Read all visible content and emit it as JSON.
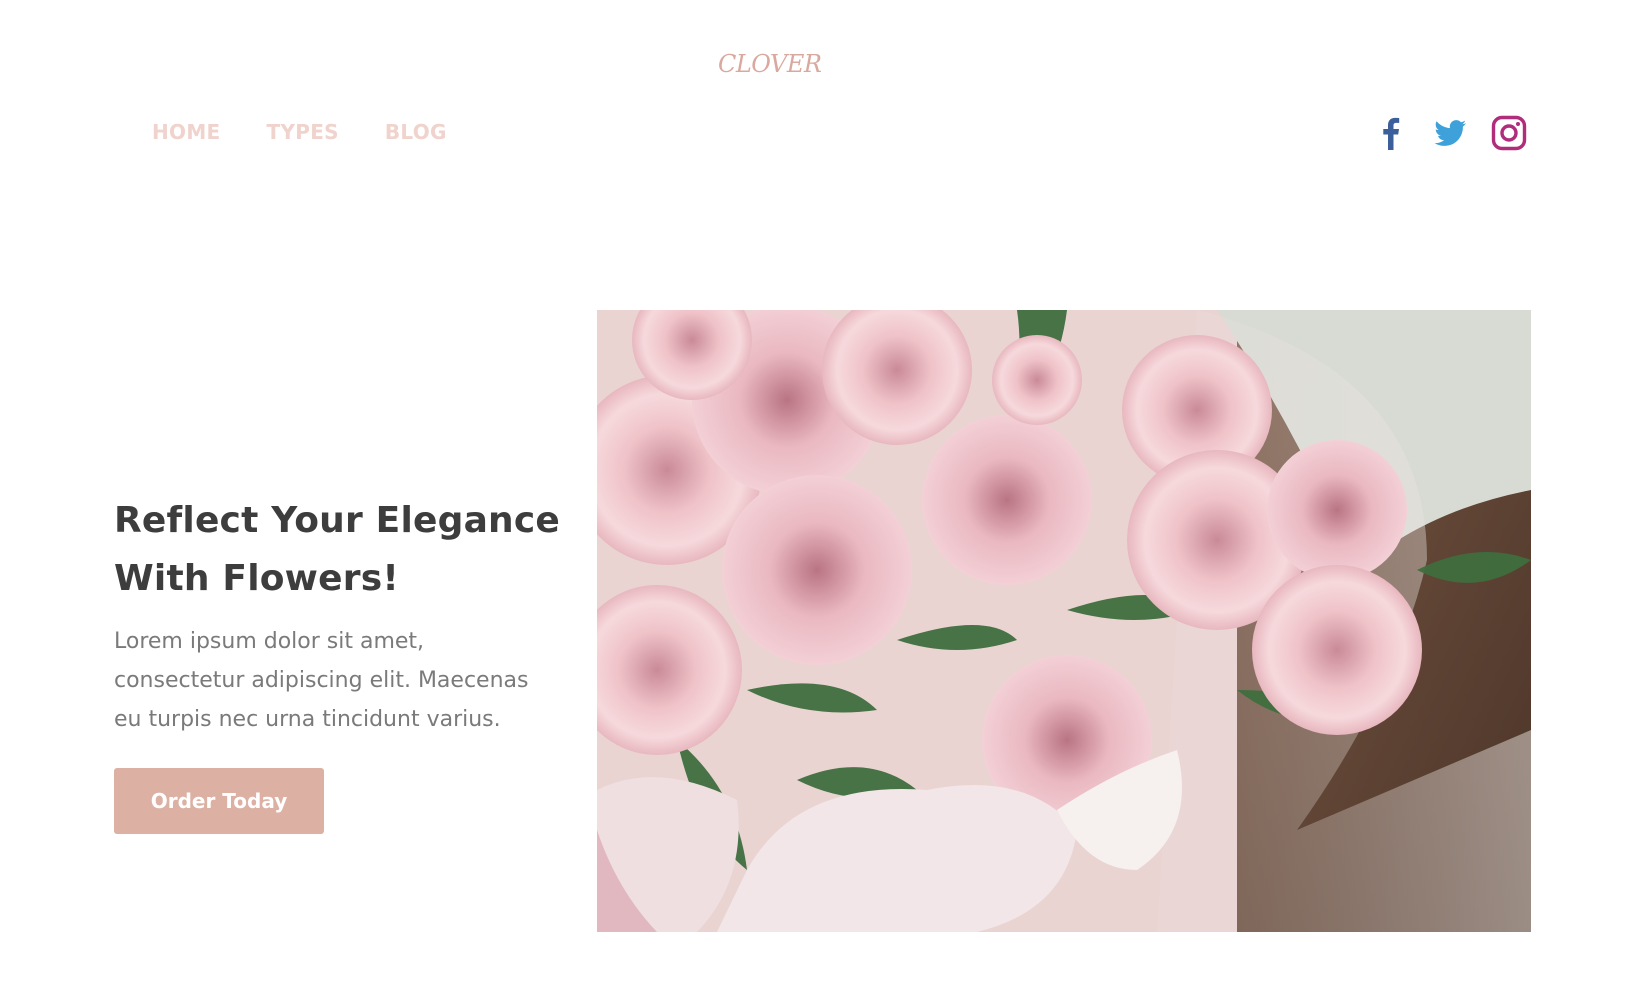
{
  "brand": {
    "logo_text": "CLOVER",
    "logo_color": "#d9a99f"
  },
  "nav": {
    "items": [
      {
        "label": "HOME"
      },
      {
        "label": "TYPES"
      },
      {
        "label": "BLOG"
      }
    ],
    "color": "#f0d3cc"
  },
  "social": {
    "icons": [
      {
        "name": "facebook-icon",
        "color": "#3b5f9a"
      },
      {
        "name": "twitter-icon",
        "color": "#3ea1d9"
      },
      {
        "name": "instagram-icon",
        "color": "#b02d7c"
      }
    ]
  },
  "hero": {
    "title": "Reflect Your Elegance With Flowers!",
    "text": "Lorem ipsum dolor sit amet, consectetur adipiscing elit. Maecenas eu turpis nec urna tincidunt varius.",
    "button_label": "Order Today",
    "button_color": "#ddb0a4",
    "image_subject": "bouquet-of-pink-roses-photo"
  }
}
